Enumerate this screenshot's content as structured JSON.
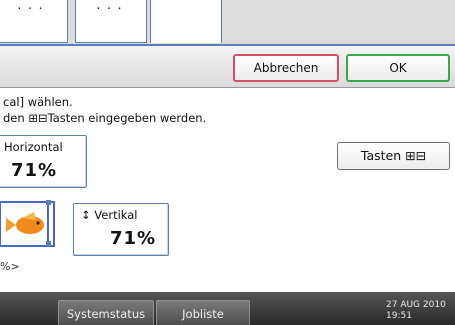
{
  "header": {
    "tabs_partial": [
      "...",
      "..."
    ],
    "cancel_label": "Abbrechen",
    "ok_label": "OK"
  },
  "instructions": {
    "line1": "cal] wählen.",
    "line2": "den ⊞⊟Tasten eingegeben werden."
  },
  "horizontal": {
    "label": "Horizontal",
    "value": "71%"
  },
  "vertical": {
    "arrow": "↕",
    "label": "Vertikal",
    "value": "71%"
  },
  "tasten": {
    "label": "Tasten ⊞⊟"
  },
  "unit_text": "%>",
  "status_bar": {
    "systemstatus_label": "Systemstatus",
    "jobliste_label": "Jobliste",
    "date": "27 AUG  2010",
    "time": "19:51"
  },
  "colors": {
    "accent_blue": "#5b7fb8",
    "cancel_border": "#d2506a",
    "ok_border": "#3aaa48",
    "status_bar": "#333333"
  }
}
